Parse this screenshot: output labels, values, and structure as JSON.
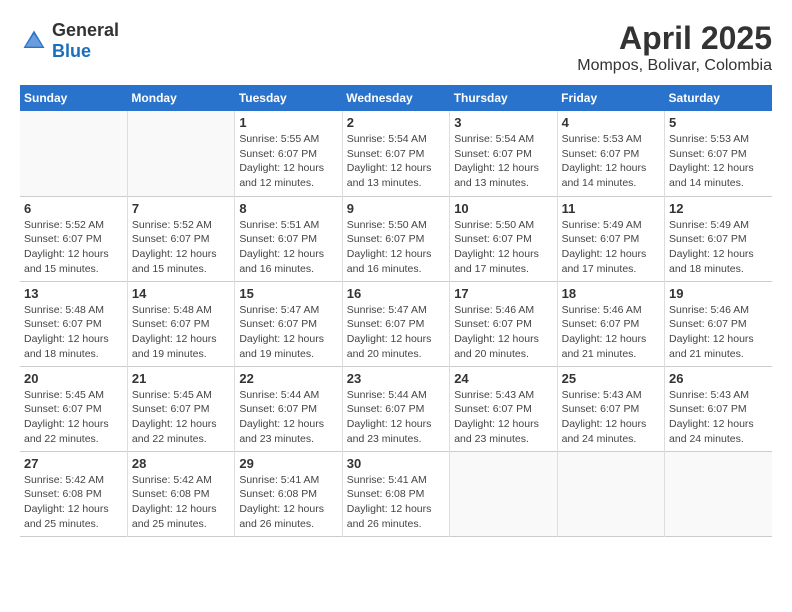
{
  "logo": {
    "general": "General",
    "blue": "Blue"
  },
  "title": "April 2025",
  "location": "Mompos, Bolivar, Colombia",
  "days_of_week": [
    "Sunday",
    "Monday",
    "Tuesday",
    "Wednesday",
    "Thursday",
    "Friday",
    "Saturday"
  ],
  "weeks": [
    [
      {
        "day": "",
        "info": ""
      },
      {
        "day": "",
        "info": ""
      },
      {
        "day": "1",
        "info": "Sunrise: 5:55 AM\nSunset: 6:07 PM\nDaylight: 12 hours and 12 minutes."
      },
      {
        "day": "2",
        "info": "Sunrise: 5:54 AM\nSunset: 6:07 PM\nDaylight: 12 hours and 13 minutes."
      },
      {
        "day": "3",
        "info": "Sunrise: 5:54 AM\nSunset: 6:07 PM\nDaylight: 12 hours and 13 minutes."
      },
      {
        "day": "4",
        "info": "Sunrise: 5:53 AM\nSunset: 6:07 PM\nDaylight: 12 hours and 14 minutes."
      },
      {
        "day": "5",
        "info": "Sunrise: 5:53 AM\nSunset: 6:07 PM\nDaylight: 12 hours and 14 minutes."
      }
    ],
    [
      {
        "day": "6",
        "info": "Sunrise: 5:52 AM\nSunset: 6:07 PM\nDaylight: 12 hours and 15 minutes."
      },
      {
        "day": "7",
        "info": "Sunrise: 5:52 AM\nSunset: 6:07 PM\nDaylight: 12 hours and 15 minutes."
      },
      {
        "day": "8",
        "info": "Sunrise: 5:51 AM\nSunset: 6:07 PM\nDaylight: 12 hours and 16 minutes."
      },
      {
        "day": "9",
        "info": "Sunrise: 5:50 AM\nSunset: 6:07 PM\nDaylight: 12 hours and 16 minutes."
      },
      {
        "day": "10",
        "info": "Sunrise: 5:50 AM\nSunset: 6:07 PM\nDaylight: 12 hours and 17 minutes."
      },
      {
        "day": "11",
        "info": "Sunrise: 5:49 AM\nSunset: 6:07 PM\nDaylight: 12 hours and 17 minutes."
      },
      {
        "day": "12",
        "info": "Sunrise: 5:49 AM\nSunset: 6:07 PM\nDaylight: 12 hours and 18 minutes."
      }
    ],
    [
      {
        "day": "13",
        "info": "Sunrise: 5:48 AM\nSunset: 6:07 PM\nDaylight: 12 hours and 18 minutes."
      },
      {
        "day": "14",
        "info": "Sunrise: 5:48 AM\nSunset: 6:07 PM\nDaylight: 12 hours and 19 minutes."
      },
      {
        "day": "15",
        "info": "Sunrise: 5:47 AM\nSunset: 6:07 PM\nDaylight: 12 hours and 19 minutes."
      },
      {
        "day": "16",
        "info": "Sunrise: 5:47 AM\nSunset: 6:07 PM\nDaylight: 12 hours and 20 minutes."
      },
      {
        "day": "17",
        "info": "Sunrise: 5:46 AM\nSunset: 6:07 PM\nDaylight: 12 hours and 20 minutes."
      },
      {
        "day": "18",
        "info": "Sunrise: 5:46 AM\nSunset: 6:07 PM\nDaylight: 12 hours and 21 minutes."
      },
      {
        "day": "19",
        "info": "Sunrise: 5:46 AM\nSunset: 6:07 PM\nDaylight: 12 hours and 21 minutes."
      }
    ],
    [
      {
        "day": "20",
        "info": "Sunrise: 5:45 AM\nSunset: 6:07 PM\nDaylight: 12 hours and 22 minutes."
      },
      {
        "day": "21",
        "info": "Sunrise: 5:45 AM\nSunset: 6:07 PM\nDaylight: 12 hours and 22 minutes."
      },
      {
        "day": "22",
        "info": "Sunrise: 5:44 AM\nSunset: 6:07 PM\nDaylight: 12 hours and 23 minutes."
      },
      {
        "day": "23",
        "info": "Sunrise: 5:44 AM\nSunset: 6:07 PM\nDaylight: 12 hours and 23 minutes."
      },
      {
        "day": "24",
        "info": "Sunrise: 5:43 AM\nSunset: 6:07 PM\nDaylight: 12 hours and 23 minutes."
      },
      {
        "day": "25",
        "info": "Sunrise: 5:43 AM\nSunset: 6:07 PM\nDaylight: 12 hours and 24 minutes."
      },
      {
        "day": "26",
        "info": "Sunrise: 5:43 AM\nSunset: 6:07 PM\nDaylight: 12 hours and 24 minutes."
      }
    ],
    [
      {
        "day": "27",
        "info": "Sunrise: 5:42 AM\nSunset: 6:08 PM\nDaylight: 12 hours and 25 minutes."
      },
      {
        "day": "28",
        "info": "Sunrise: 5:42 AM\nSunset: 6:08 PM\nDaylight: 12 hours and 25 minutes."
      },
      {
        "day": "29",
        "info": "Sunrise: 5:41 AM\nSunset: 6:08 PM\nDaylight: 12 hours and 26 minutes."
      },
      {
        "day": "30",
        "info": "Sunrise: 5:41 AM\nSunset: 6:08 PM\nDaylight: 12 hours and 26 minutes."
      },
      {
        "day": "",
        "info": ""
      },
      {
        "day": "",
        "info": ""
      },
      {
        "day": "",
        "info": ""
      }
    ]
  ]
}
